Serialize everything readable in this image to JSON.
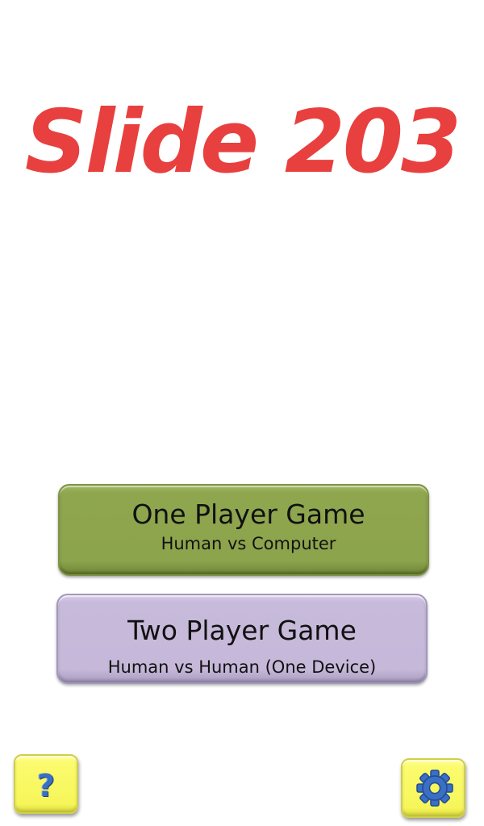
{
  "title": "Slide 203",
  "menu": {
    "one_player": {
      "label": "One Player Game",
      "subtitle": "Human vs Computer"
    },
    "two_player": {
      "label": "Two Player Game",
      "subtitle": "Human vs Human (One Device)"
    }
  },
  "corner_buttons": {
    "help": {
      "glyph": "?",
      "icon": "question-mark-icon"
    },
    "settings": {
      "icon": "gear-icon"
    }
  },
  "colors": {
    "title": "#e8403f",
    "one_player_button": "#8ca44c",
    "two_player_button": "#c5b8d9",
    "corner_button": "#f6f65a",
    "icon_blue": "#3a6fc4"
  }
}
